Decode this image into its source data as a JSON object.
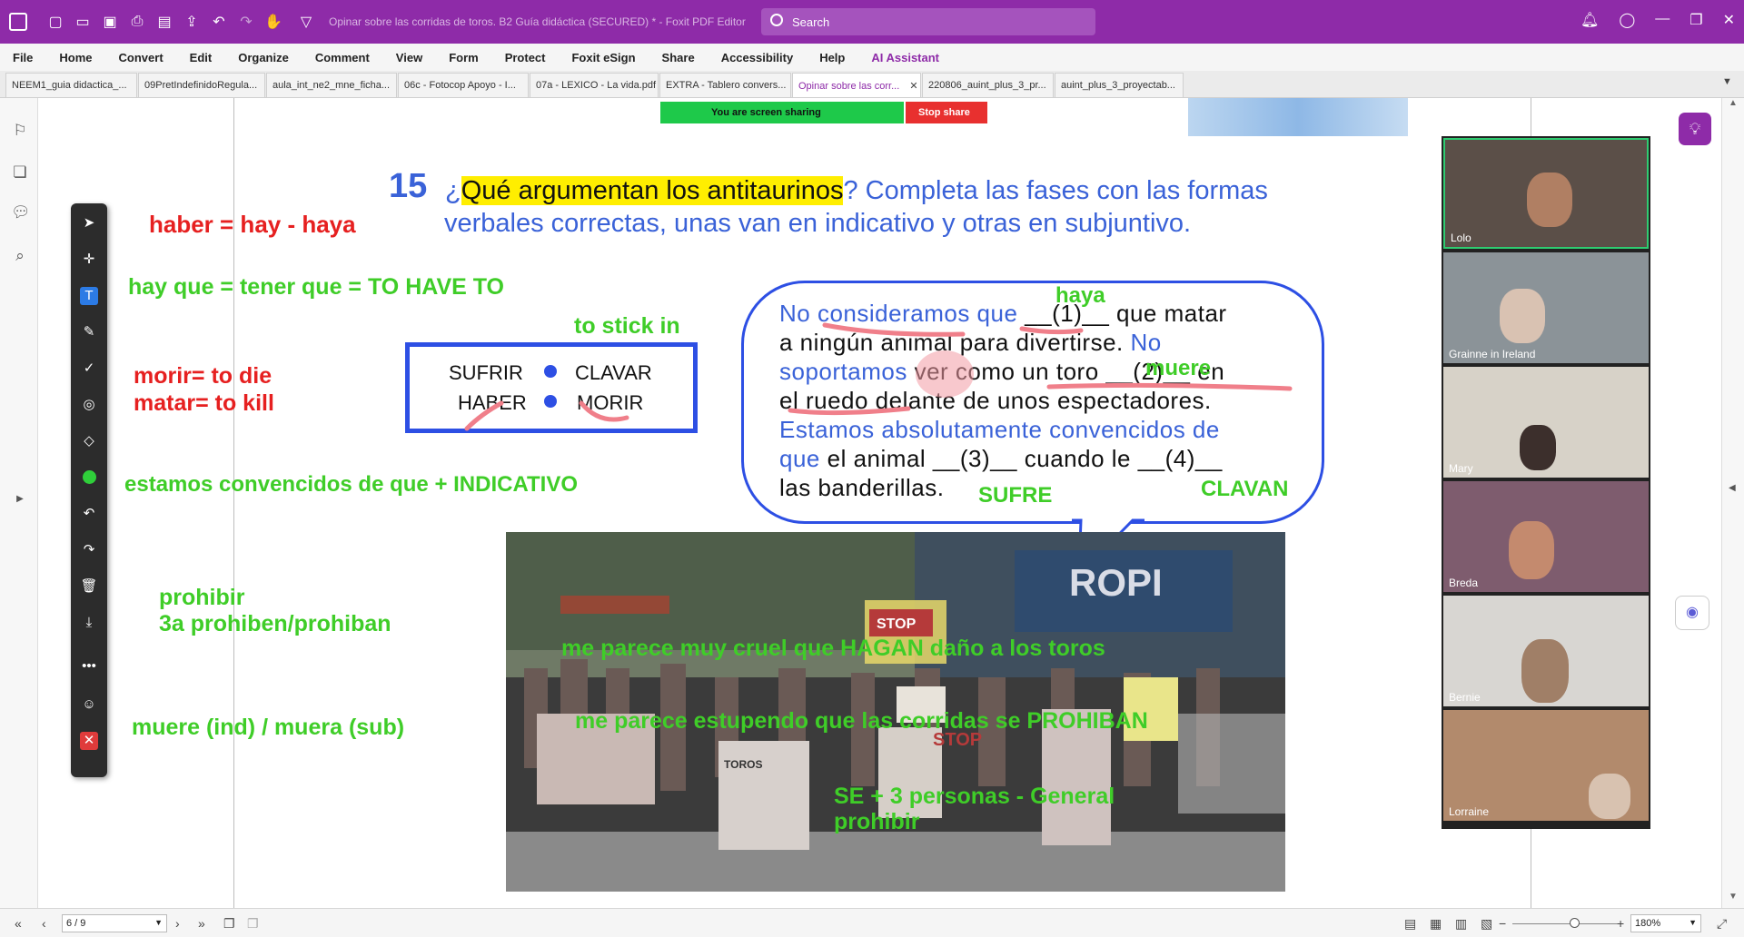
{
  "window": {
    "title": "Opinar sobre las corridas de toros. B2 Guía didáctica (SECURED) * - Foxit PDF Editor",
    "search_placeholder": "Search"
  },
  "menu": [
    "File",
    "Home",
    "Convert",
    "Edit",
    "Organize",
    "Comment",
    "View",
    "Form",
    "Protect",
    "Foxit eSign",
    "Share",
    "Accessibility",
    "Help",
    "AI Assistant"
  ],
  "tabs": [
    {
      "label": "NEEM1_guia didactica_..."
    },
    {
      "label": "09PretIndefinidoRegula..."
    },
    {
      "label": "aula_int_ne2_mne_ficha..."
    },
    {
      "label": "06c - Fotocop Apoyo - I..."
    },
    {
      "label": "07a - LEXICO - La vida.pdf"
    },
    {
      "label": "EXTRA - Tablero convers..."
    },
    {
      "label": "Opinar sobre las corr..."
    },
    {
      "label": "220806_auint_plus_3_pr..."
    },
    {
      "label": "auint_plus_3_proyectab..."
    }
  ],
  "share": {
    "status": "You are screen sharing",
    "stop": "Stop share"
  },
  "slide": {
    "number": "15",
    "q_pre": "¿",
    "q_highlight": "Qué argumentan los antitaurinos",
    "q_rest": "? Completa las fases con las formas",
    "q_line2": "verbales correctas, unas van en indicativo y otras en subjuntivo.",
    "verbs": {
      "v1": "SUFRIR",
      "v2": "CLAVAR",
      "v3": "HABER",
      "v4": "MORIR"
    },
    "bubble": {
      "l1a": "No consideramos que",
      "l1b": "__(1)__ que matar",
      "l2a": "a   ningún   animal   para   divertirse.",
      "l2b": "No",
      "l3a": "soportamos",
      "l3b": "ver como un toro __(2)__ en",
      "l4": "el ruedo delante de unos espectadores.",
      "l5": "Estamos absolutamente convencidos de",
      "l6a": "que",
      "l6b": "el animal __(3)__ cuando le __(4)__",
      "l7": "las banderillas."
    }
  },
  "annotations": {
    "a1": "haber = hay - haya",
    "a2": "hay que = tener que = TO HAVE TO",
    "a3": "to stick in",
    "a4": "morir= to die",
    "a5": "matar= to kill",
    "a6": "estamos convencidos de que + INDICATIVO",
    "a7": "prohibir",
    "a8": "3a  prohiben/prohiban",
    "a9": "muere (ind) / muera (sub)",
    "b1": "haya",
    "b2": "muere",
    "b3": "SUFRE",
    "b4": "CLAVAN",
    "p1": "me parece  muy cruel que  HAGAN daño a los toros",
    "p2": "me parece estupendo que las corridas se PROHIBAN",
    "p3": "SE + 3 personas - General",
    "p4": "prohibir"
  },
  "photo_signs": {
    "s1": "STOP",
    "s2": "TOROS",
    "s3": "STOP"
  },
  "participants": [
    {
      "name": "Lolo"
    },
    {
      "name": "Grainne in Ireland"
    },
    {
      "name": "Mary"
    },
    {
      "name": "Breda"
    },
    {
      "name": "Bernie"
    },
    {
      "name": "Lorraine"
    }
  ],
  "status": {
    "page": "6 / 9",
    "zoom": "180%"
  },
  "colors": {
    "brand": "#8e2ba8",
    "annotation_red": "#e62020",
    "annotation_green": "#3fcd28",
    "slide_blue": "#3a62d8"
  }
}
